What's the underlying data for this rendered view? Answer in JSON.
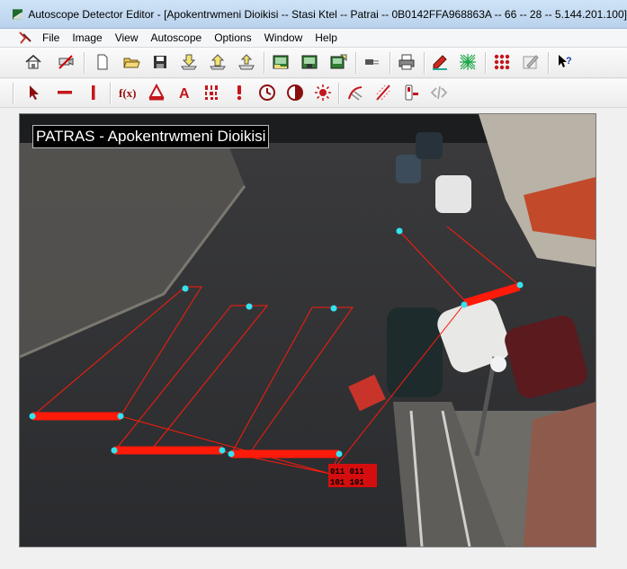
{
  "window": {
    "title": "Autoscope Detector Editor - [Apokentrwmeni Dioikisi -- Stasi Ktel -- Patrai -- 0B0142FFA968863A -- 66 -- 28 -- 5.144.201.100]"
  },
  "menu": [
    "File",
    "Image",
    "View",
    "Autoscope",
    "Options",
    "Window",
    "Help"
  ],
  "toolbar_main": [
    {
      "name": "home-button",
      "icon": "home-icon"
    },
    {
      "name": "connect-camera-button",
      "icon": "camera-icon"
    },
    {
      "name": "new-button",
      "icon": "new-document-icon"
    },
    {
      "name": "open-button",
      "icon": "open-folder-icon"
    },
    {
      "name": "save-button",
      "icon": "floppy-disk-icon"
    },
    {
      "name": "download-config-button",
      "icon": "download-icon"
    },
    {
      "name": "upload-config-button",
      "icon": "upload-icon"
    },
    {
      "name": "transfer-button",
      "icon": "transfer-icon"
    },
    {
      "name": "open-image-button",
      "icon": "image-open-icon"
    },
    {
      "name": "save-image-button",
      "icon": "image-save-icon"
    },
    {
      "name": "export-image-button",
      "icon": "image-export-icon"
    },
    {
      "name": "connection-button",
      "icon": "plug-icon"
    },
    {
      "name": "print-button",
      "icon": "printer-icon"
    },
    {
      "name": "edit-detectors-button",
      "icon": "pencil-icon"
    },
    {
      "name": "detector-grid-button",
      "icon": "grid-icon"
    },
    {
      "name": "matrix-button",
      "icon": "dots-matrix-icon"
    },
    {
      "name": "edit-disabled-button",
      "icon": "edit-icon"
    },
    {
      "name": "context-help-button",
      "icon": "help-pointer-icon"
    }
  ],
  "toolbar_draw": [
    {
      "name": "select-tool",
      "icon": "arrow-pointer-icon"
    },
    {
      "name": "count-detector-tool",
      "icon": "horizontal-bar-icon"
    },
    {
      "name": "presence-detector-tool",
      "icon": "vertical-bar-icon"
    },
    {
      "name": "function-tool",
      "icon": "function-icon"
    },
    {
      "name": "speed-detector-tool",
      "icon": "triangle-icon"
    },
    {
      "name": "text-tool",
      "icon": "letter-a-icon"
    },
    {
      "name": "binary-tool",
      "icon": "binary-icon"
    },
    {
      "name": "incident-tool",
      "icon": "exclamation-icon"
    },
    {
      "name": "time-tool",
      "icon": "clock-icon"
    },
    {
      "name": "contrast-tool",
      "icon": "contrast-icon"
    },
    {
      "name": "light-tool",
      "icon": "sun-icon"
    },
    {
      "name": "direction-tool",
      "icon": "direction-icon"
    },
    {
      "name": "lane-tool",
      "icon": "lane-icon"
    },
    {
      "name": "signal-tool",
      "icon": "signal-icon"
    },
    {
      "name": "disabled-tool",
      "icon": "code-icon"
    }
  ],
  "video": {
    "caption": "PATRAS - Apokentrwmeni Dioikisi",
    "binary_indicator": [
      "011 011",
      "101 101"
    ],
    "detector_color": "#ff1a0a",
    "handle_color": "#35e3f0"
  }
}
